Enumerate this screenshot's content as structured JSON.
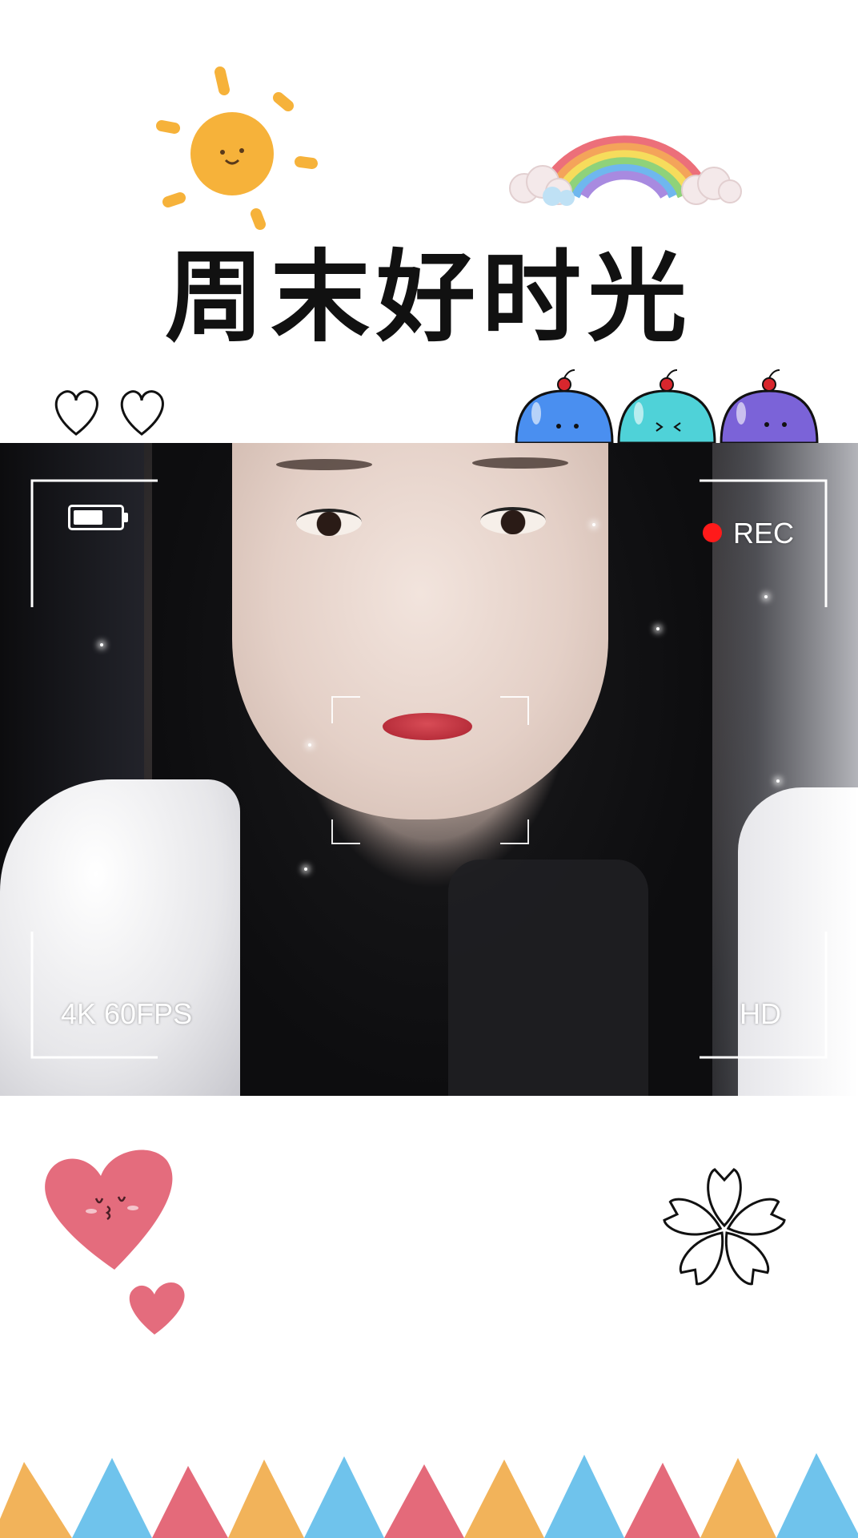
{
  "banner": {
    "title": "周末好时光"
  },
  "camera_overlay": {
    "rec_label": "REC",
    "quality_label": "4K 60FPS",
    "hd_label": "HD",
    "battery_level": 0.65,
    "recording_indicator_color": "#ff1a1a"
  },
  "decorations": {
    "sun_color": "#f6b23a",
    "heart_color": "#e46c7d",
    "blob_colors": [
      "#4a8ff0",
      "#4fd2d8",
      "#7b63d8"
    ],
    "bunting_colors": [
      "#f2b35a",
      "#6fc3ec",
      "#e46a7a"
    ]
  }
}
